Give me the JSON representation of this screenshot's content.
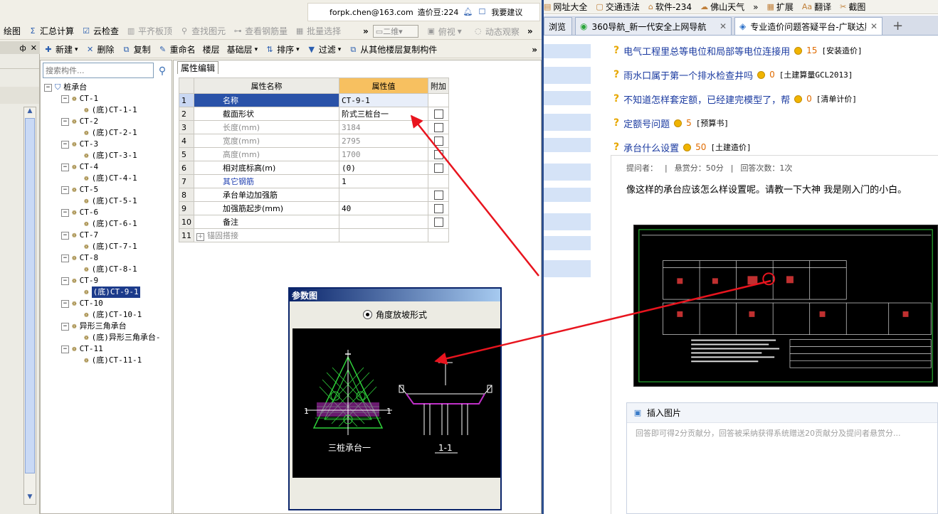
{
  "top_info": {
    "email": "forpk.chen@163.com",
    "bean_label": "造价豆:224",
    "suggest_label": "我要建议"
  },
  "toolbar1": [
    {
      "label": "绘图",
      "icon": "",
      "disabled": false
    },
    {
      "label": "汇总计算",
      "icon": "Σ",
      "disabled": false
    },
    {
      "label": "云检查",
      "icon": "☑",
      "disabled": false
    },
    {
      "label": "平齐板顶",
      "icon": "▥",
      "disabled": true
    },
    {
      "label": "查找图元",
      "icon": "⚲",
      "disabled": true
    },
    {
      "label": "查看钢筋量",
      "icon": "⊶",
      "disabled": true
    },
    {
      "label": "批量选择",
      "icon": "▦",
      "disabled": true
    }
  ],
  "toolbar1_right": {
    "more": "»",
    "view_select": "二维",
    "view_label": "俯视",
    "dynamic_label": "动态观察"
  },
  "left_header": {
    "pin": "ф",
    "close": "✕"
  },
  "toolbar2": [
    {
      "label": "新建",
      "icon": "✚",
      "dropdown": true
    },
    {
      "label": "删除",
      "icon": "✕",
      "dropdown": false
    },
    {
      "label": "复制",
      "icon": "⧉",
      "dropdown": false
    },
    {
      "label": "重命名",
      "icon": "✎",
      "dropdown": false
    },
    {
      "label": "楼层",
      "icon": "",
      "dropdown": false
    },
    {
      "label": "基础层",
      "icon": "",
      "dropdown": true
    },
    {
      "label": "排序",
      "icon": "⇅",
      "dropdown": true
    },
    {
      "label": "过滤",
      "icon": "▼",
      "dropdown": true
    },
    {
      "label": "从其他楼层复制构件",
      "icon": "⧉",
      "dropdown": false
    }
  ],
  "toolbar2_more": "»",
  "search": {
    "placeholder": "搜索构件..."
  },
  "tree": [
    {
      "label": "桩承台",
      "level": 0,
      "toggle": "−",
      "icon": "pile-cap",
      "selected": false
    },
    {
      "label": "CT-1",
      "level": 1,
      "toggle": "−",
      "icon": "gear",
      "selected": false
    },
    {
      "label": "(底)CT-1-1",
      "level": 2,
      "toggle": "",
      "icon": "gear",
      "selected": false
    },
    {
      "label": "CT-2",
      "level": 1,
      "toggle": "−",
      "icon": "gear",
      "selected": false
    },
    {
      "label": "(底)CT-2-1",
      "level": 2,
      "toggle": "",
      "icon": "gear",
      "selected": false
    },
    {
      "label": "CT-3",
      "level": 1,
      "toggle": "−",
      "icon": "gear",
      "selected": false
    },
    {
      "label": "(底)CT-3-1",
      "level": 2,
      "toggle": "",
      "icon": "gear",
      "selected": false
    },
    {
      "label": "CT-4",
      "level": 1,
      "toggle": "−",
      "icon": "gear",
      "selected": false
    },
    {
      "label": "(底)CT-4-1",
      "level": 2,
      "toggle": "",
      "icon": "gear",
      "selected": false
    },
    {
      "label": "CT-5",
      "level": 1,
      "toggle": "−",
      "icon": "gear",
      "selected": false
    },
    {
      "label": "(底)CT-5-1",
      "level": 2,
      "toggle": "",
      "icon": "gear",
      "selected": false
    },
    {
      "label": "CT-6",
      "level": 1,
      "toggle": "−",
      "icon": "gear",
      "selected": false
    },
    {
      "label": "(底)CT-6-1",
      "level": 2,
      "toggle": "",
      "icon": "gear",
      "selected": false
    },
    {
      "label": "CT-7",
      "level": 1,
      "toggle": "−",
      "icon": "gear",
      "selected": false
    },
    {
      "label": "(底)CT-7-1",
      "level": 2,
      "toggle": "",
      "icon": "gear",
      "selected": false
    },
    {
      "label": "CT-8",
      "level": 1,
      "toggle": "−",
      "icon": "gear",
      "selected": false
    },
    {
      "label": "(底)CT-8-1",
      "level": 2,
      "toggle": "",
      "icon": "gear",
      "selected": false
    },
    {
      "label": "CT-9",
      "level": 1,
      "toggle": "−",
      "icon": "gear",
      "selected": false
    },
    {
      "label": "(底)CT-9-1",
      "level": 2,
      "toggle": "",
      "icon": "gear",
      "selected": true
    },
    {
      "label": "CT-10",
      "level": 1,
      "toggle": "−",
      "icon": "gear",
      "selected": false
    },
    {
      "label": "(底)CT-10-1",
      "level": 2,
      "toggle": "",
      "icon": "gear",
      "selected": false
    },
    {
      "label": "异形三角承台",
      "level": 1,
      "toggle": "−",
      "icon": "gear",
      "selected": false
    },
    {
      "label": "(底)异形三角承台-",
      "level": 2,
      "toggle": "",
      "icon": "gear",
      "selected": false
    },
    {
      "label": "CT-11",
      "level": 1,
      "toggle": "−",
      "icon": "gear",
      "selected": false
    },
    {
      "label": "(底)CT-11-1",
      "level": 2,
      "toggle": "",
      "icon": "gear",
      "selected": false
    }
  ],
  "prop_tab": "属性编辑",
  "prop_headers": {
    "name": "属性名称",
    "value": "属性值",
    "extra": "附加"
  },
  "props": [
    {
      "n": "1",
      "name": "名称",
      "value": "CT-9-1",
      "check": false,
      "style": "selected"
    },
    {
      "n": "2",
      "name": "截面形状",
      "value": "阶式三桩台一",
      "check": true,
      "style": ""
    },
    {
      "n": "3",
      "name": "长度(mm)",
      "value": "3184",
      "check": true,
      "style": "grey"
    },
    {
      "n": "4",
      "name": "宽度(mm)",
      "value": "2795",
      "check": true,
      "style": "grey"
    },
    {
      "n": "5",
      "name": "高度(mm)",
      "value": "1700",
      "check": true,
      "style": "grey"
    },
    {
      "n": "6",
      "name": "相对底标高(m)",
      "value": "(0)",
      "check": true,
      "style": ""
    },
    {
      "n": "7",
      "name": "其它钢筋",
      "value": "1",
      "check": false,
      "style": "blue"
    },
    {
      "n": "8",
      "name": "承台单边加强筋",
      "value": "",
      "check": true,
      "style": ""
    },
    {
      "n": "9",
      "name": "加强筋起步(mm)",
      "value": "40",
      "check": true,
      "style": ""
    },
    {
      "n": "10",
      "name": "备注",
      "value": "",
      "check": true,
      "style": ""
    },
    {
      "n": "11",
      "name": "锚固搭接",
      "value": "",
      "check": false,
      "style": "grey-expand",
      "expand": "+"
    }
  ],
  "dialog": {
    "title": "参数图",
    "radio_label": "角度放坡形式",
    "label_plan": "三桩承台一",
    "label_section": "1-1",
    "mark_1": "1"
  },
  "browser": {
    "favorites": [
      "网址大全",
      "交通违法",
      "软件-234",
      "佛山天气",
      "»",
      "扩展",
      "翻译",
      "截图"
    ],
    "tabs": [
      {
        "label": "浏览",
        "active": false
      },
      {
        "label": "360导航_新一代安全上网导航",
        "active": false
      },
      {
        "label": "专业造价问题答疑平台-广联达服",
        "active": true
      }
    ],
    "new_tab": "+",
    "close": "✕"
  },
  "questions": [
    {
      "title": "电气工程里总等电位和局部等电位连接用",
      "points": "15",
      "category": "[安装造价]"
    },
    {
      "title": "雨水口属于第一个排水检查井吗",
      "points": "0",
      "category": "[土建算量GCL2013]"
    },
    {
      "title": "不知道怎样套定额，已经建完模型了，帮",
      "points": "0",
      "category": "[清单计价]"
    },
    {
      "title": "定额号问题",
      "points": "5",
      "category": "[预算书]"
    },
    {
      "title": "承台什么设置",
      "points": "50",
      "category": "[土建造价]"
    }
  ],
  "question_meta": {
    "asker": "提问者：",
    "sep": "|",
    "reward": "悬赏分：50分",
    "answers": "回答次数：1次"
  },
  "question_body": "像这样的承台应该怎么样设置呢。请教一下大神 我是刚入门的小白。",
  "answer_box": {
    "insert_image": "插入图片",
    "placeholder": "回答即可得2分贡献分，回答被采纳获得系统赠送20贡献分及提问者悬赏分..."
  },
  "colors": {
    "arrow": "#e8141e",
    "selection": "#1c3b8b",
    "value_header": "#f7c060",
    "link": "#1a3aa0",
    "points": "#e06b00"
  }
}
